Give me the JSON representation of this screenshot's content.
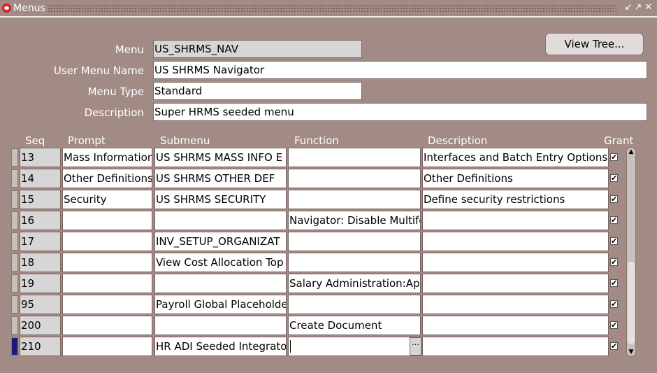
{
  "window": {
    "title": "Menus",
    "controls": [
      "↙",
      "↗",
      "✕"
    ]
  },
  "header": {
    "menu_label": "Menu",
    "menu_value": "US_SHRMS_NAV",
    "user_menu_name_label": "User Menu Name",
    "user_menu_name_value": "US SHRMS Navigator",
    "menu_type_label": "Menu Type",
    "menu_type_value": "Standard",
    "description_label": "Description",
    "description_value": "Super HRMS seeded menu",
    "view_tree_label": "View Tree..."
  },
  "grid": {
    "columns": {
      "seq": "Seq",
      "prompt": "Prompt",
      "submenu": "Submenu",
      "function": "Function",
      "description": "Description",
      "grant": "Grant"
    },
    "rows": [
      {
        "seq": "13",
        "prompt": "Mass Information",
        "submenu": "US SHRMS MASS INFO E",
        "function": "",
        "description": "Interfaces and Batch Entry Options",
        "grant": "✔"
      },
      {
        "seq": "14",
        "prompt": "Other Definitions",
        "submenu": "US SHRMS OTHER DEF",
        "function": "",
        "description": "Other Definitions",
        "grant": "✔"
      },
      {
        "seq": "15",
        "prompt": "Security",
        "submenu": "US SHRMS SECURITY",
        "function": "",
        "description": "Define security restrictions",
        "grant": "✔"
      },
      {
        "seq": "16",
        "prompt": "",
        "submenu": "",
        "function": "Navigator: Disable Multifor",
        "description": "",
        "grant": "✔"
      },
      {
        "seq": "17",
        "prompt": "",
        "submenu": "INV_SETUP_ORGANIZAT",
        "function": "",
        "description": "",
        "grant": "✔"
      },
      {
        "seq": "18",
        "prompt": "",
        "submenu": "View Cost Allocation Top I",
        "function": "",
        "description": "",
        "grant": "✔"
      },
      {
        "seq": "19",
        "prompt": "",
        "submenu": "",
        "function": "Salary Administration:App",
        "description": "",
        "grant": "✔"
      },
      {
        "seq": "95",
        "prompt": "",
        "submenu": "Payroll Global Placeholder",
        "function": "",
        "description": "",
        "grant": "✔"
      },
      {
        "seq": "200",
        "prompt": "",
        "submenu": "",
        "function": "Create Document",
        "description": "",
        "grant": "✔"
      },
      {
        "seq": "210",
        "prompt": "",
        "submenu": "HR ADI Seeded Integrator",
        "function": "",
        "description": "",
        "grant": "✔"
      }
    ],
    "lov_button": "···",
    "scroll_up": "▲",
    "scroll_down": "▼"
  }
}
